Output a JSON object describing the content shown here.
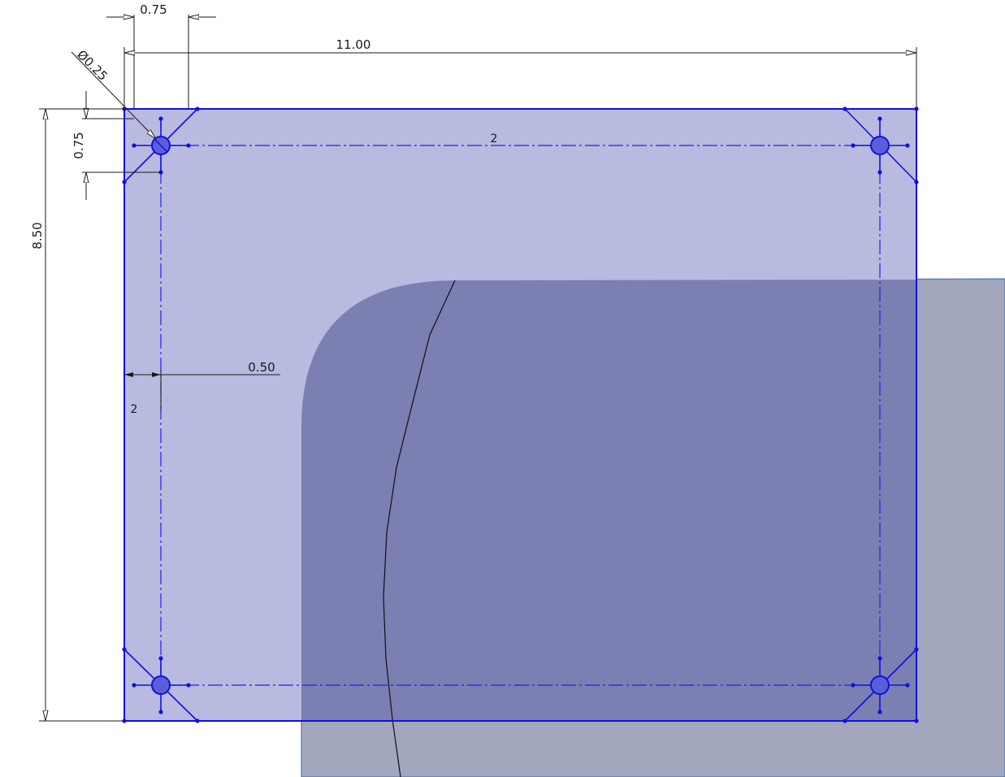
{
  "colors": {
    "background": "#ffffff",
    "model_face": "#a2a7bd",
    "sketch_fill": "#b9bae0",
    "overlap_fill": "#7b7fb1",
    "sketch_line": "#1010e0",
    "dimension_line": "#1a1a1a",
    "centerline": "#2222e8"
  },
  "dimensions": {
    "hole_offset_x": "0.75",
    "overall_width": "11.00",
    "hole_diameter": "Ø0.25",
    "hole_offset_y": "0.75",
    "overall_height": "8.50",
    "edge_offset": "0.50"
  },
  "relations": {
    "top_centerline": "2",
    "left_offset_tag": "2"
  },
  "sketch": {
    "holes": [
      {
        "name": "hole-top-left"
      },
      {
        "name": "hole-top-right"
      },
      {
        "name": "hole-bottom-left"
      },
      {
        "name": "hole-bottom-right"
      }
    ]
  }
}
